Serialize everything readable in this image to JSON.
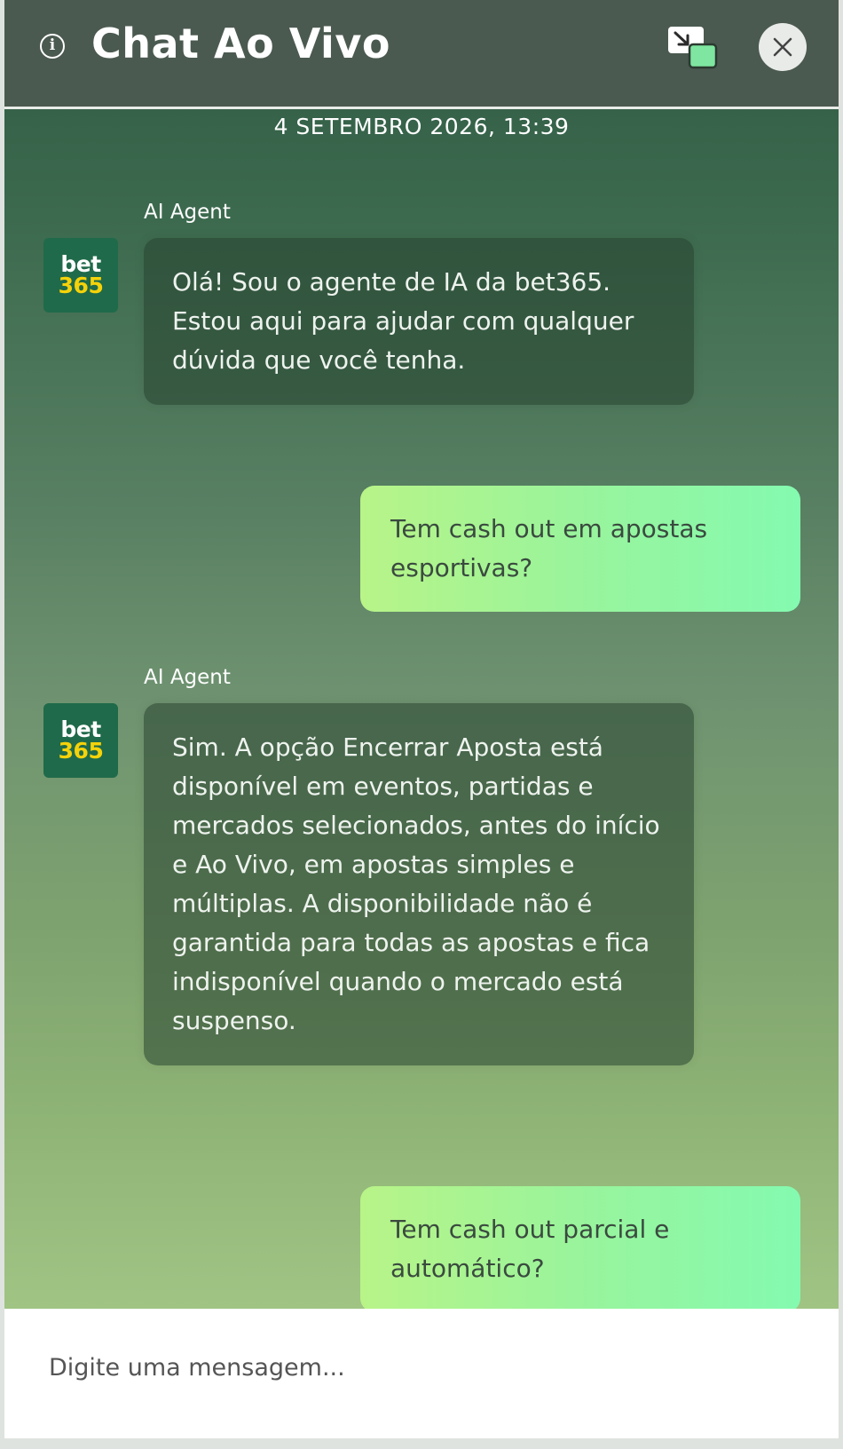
{
  "header": {
    "title": "Chat Ao Vivo",
    "info_icon": "info-icon",
    "popout_icon": "popout-window-icon",
    "close_icon": "close-icon"
  },
  "chat": {
    "timestamp": "4 SETEMBRO 2026, 13:39",
    "messages": [
      {
        "role": "agent",
        "sender": "AI Agent",
        "avatar": {
          "line1": "bet",
          "line2": "365"
        },
        "text": "Olá! Sou o agente de IA da bet365. Estou aqui para ajudar com qualquer dúvida que você tenha."
      },
      {
        "role": "user",
        "text": "Tem cash out em apostas esportivas?"
      },
      {
        "role": "agent",
        "sender": "AI Agent",
        "avatar": {
          "line1": "bet",
          "line2": "365"
        },
        "text": "Sim. A opção Encerrar Aposta está disponível em eventos, partidas e mercados selecionados, antes do início e Ao Vivo, em apostas simples e múltiplas. A disponibilidade não é garantida para todas as apostas e fica indisponível quando o mercado está suspenso."
      },
      {
        "role": "user",
        "text": "Tem cash out parcial e automático?"
      }
    ]
  },
  "composer": {
    "placeholder": "Digite uma mensagem..."
  },
  "colors": {
    "header_bg": "#4b5a50",
    "brand_green": "#1f6a4a",
    "brand_yellow": "#f5d20a",
    "user_bubble_start": "#b8f488",
    "user_bubble_end": "#84fab0"
  }
}
